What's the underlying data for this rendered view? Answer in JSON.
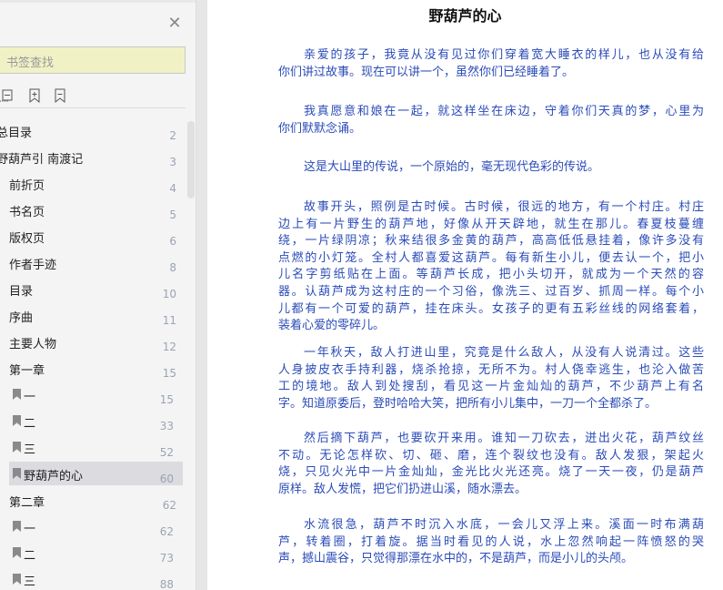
{
  "sidebar": {
    "search_placeholder": "书签查找",
    "close_icon": "close-icon",
    "tools": [
      "collapse-all-icon",
      "add-bookmark-icon",
      "remove-bookmark-icon"
    ],
    "items": [
      {
        "label": "总目录",
        "page": "2",
        "level": 0
      },
      {
        "label": "野葫芦引 南渡记",
        "page": "3",
        "level": 0
      },
      {
        "label": "前折页",
        "page": "4",
        "level": 1
      },
      {
        "label": "书名页",
        "page": "5",
        "level": 1
      },
      {
        "label": "版权页",
        "page": "6",
        "level": 1
      },
      {
        "label": "作者手迹",
        "page": "8",
        "level": 1
      },
      {
        "label": "目录",
        "page": "10",
        "level": 1
      },
      {
        "label": "序曲",
        "page": "11",
        "level": 1
      },
      {
        "label": "主要人物",
        "page": "12",
        "level": 1
      },
      {
        "label": "第一章",
        "page": "15",
        "level": 1
      },
      {
        "label": "一",
        "page": "15",
        "level": 2
      },
      {
        "label": "二",
        "page": "33",
        "level": 2
      },
      {
        "label": "三",
        "page": "52",
        "level": 2
      },
      {
        "label": "野葫芦的心",
        "page": "60",
        "level": 2,
        "selected": true
      },
      {
        "label": "第二章",
        "page": "62",
        "level": 1
      },
      {
        "label": "一",
        "page": "62",
        "level": 2
      },
      {
        "label": "二",
        "page": "73",
        "level": 2
      },
      {
        "label": "三",
        "page": "88",
        "level": 2
      }
    ]
  },
  "document": {
    "title": "野葫芦的心",
    "text_color": "#2b4cb8",
    "paragraphs": [
      [
        "亲爱的孩子，我竟从没有见过你们穿着宽大睡衣的样儿，也从没有给",
        "你们讲过故事。现在可以讲一个，虽然你们已经睡着了。"
      ],
      [
        "我真愿意和娘在一起，就这样坐在床边，守着你们天真的梦，心里为",
        "你们默默念诵。"
      ],
      [
        "这是大山里的传说，一个原始的，毫无现代色彩的传说。"
      ],
      [
        "故事开头，照例是古时候。古时候，很远的地方，有一个村庄。村庄",
        "边上有一片野生的葫芦地，好像从开天辟地，就生在那儿。春夏枝蔓缠",
        "绕，一片绿阴凉；秋来结很多金黄的葫芦，高高低低悬挂着，像许多没有",
        "点燃的小灯笼。全村人都喜爱这葫芦。每有新生小儿，便去认一个，把小",
        "儿名字剪纸贴在上面。等葫芦长成，把小头切开，就成为一个天然的容",
        "器。认葫芦成为这村庄的一个习俗，像洗三、过百岁、抓周一样。每个小",
        "儿都有一个可爱的葫芦，挂在床头。女孩子的更有五彩丝线的网络套着，",
        "装着心爱的零碎儿。"
      ],
      [
        "一年秋天，敌人打进山里，究竟是什么敌人，从没有人说清过。这些",
        "人身披皮衣手持利器，烧杀抢掠，无所不为。村人侥幸逃生，也沦入做苦",
        "工的境地。敌人到处搜刮，看见这一片金灿灿的葫芦，不少葫芦上有名",
        "字。知道原委后，登时哈哈大笑，把所有小儿集中，一刀一个全都杀了。"
      ],
      [
        "然后摘下葫芦，也要砍开来用。谁知一刀砍去，迸出火花，葫芦纹丝",
        "不动。无论怎样砍、切、砸、磨，连个裂纹也没有。敌人发狠，架起火",
        "烧，只见火光中一片金灿灿，金光比火光还亮。烧了一天一夜，仍是葫芦",
        "原样。敌人发慌，把它们扔进山溪，随水漂去。"
      ],
      [
        "水流很急，葫芦不时沉入水底，一会儿又浮上来。溪面一时布满葫",
        "芦，转着圈，打着旋。据当时看见的人说，水上忽然响起一阵愤怒的哭",
        "声，撼山震谷，只觉得那漂在水中的，不是葫芦，而是小儿的头颅。"
      ]
    ]
  }
}
